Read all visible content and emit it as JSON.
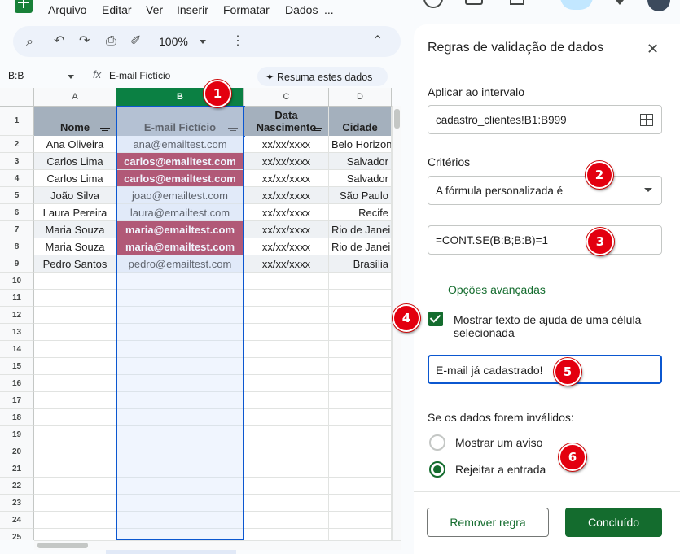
{
  "menu": [
    "Arquivo",
    "Editar",
    "Ver",
    "Inserir",
    "Formatar",
    "Dados",
    "..."
  ],
  "toolbar": {
    "zoom": "100%"
  },
  "formula_bar": {
    "name_box": "B:B",
    "content": "E-mail Fictício",
    "summarize": "Resuma estes dados"
  },
  "sheet": {
    "columns": [
      "A",
      "B",
      "C",
      "D"
    ],
    "headers": [
      "Nome",
      "E-mail Fictício",
      "Data\nNascimento",
      "Cidade"
    ],
    "rows": [
      {
        "name": "Ana Oliveira",
        "email": "ana@emailtest.com",
        "date": "xx/xx/xxxx",
        "city": "Belo Horizonte",
        "dup": false
      },
      {
        "name": "Carlos Lima",
        "email": "carlos@emailtest.com",
        "date": "xx/xx/xxxx",
        "city": "Salvador",
        "dup": true
      },
      {
        "name": "Carlos Lima",
        "email": "carlos@emailtest.com",
        "date": "xx/xx/xxxx",
        "city": "Salvador",
        "dup": true
      },
      {
        "name": "João Silva",
        "email": "joao@emailtest.com",
        "date": "xx/xx/xxxx",
        "city": "São Paulo",
        "dup": false
      },
      {
        "name": "Laura Pereira",
        "email": "laura@emailtest.com",
        "date": "xx/xx/xxxx",
        "city": "Recife",
        "dup": false
      },
      {
        "name": "Maria Souza",
        "email": "maria@emailtest.com",
        "date": "xx/xx/xxxx",
        "city": "Rio de Janeiro",
        "dup": true
      },
      {
        "name": "Maria Souza",
        "email": "maria@emailtest.com",
        "date": "xx/xx/xxxx",
        "city": "Rio de Janeiro",
        "dup": true
      },
      {
        "name": "Pedro Santos",
        "email": "pedro@emailtest.com",
        "date": "xx/xx/xxxx",
        "city": "Brasília",
        "dup": false
      }
    ],
    "row_numbers": [
      "1",
      "2",
      "3",
      "4",
      "5",
      "6",
      "7",
      "8",
      "9",
      "10",
      "11",
      "12",
      "13",
      "14",
      "15",
      "16",
      "17",
      "18",
      "19",
      "20",
      "21",
      "22",
      "23",
      "24",
      "25"
    ]
  },
  "panel": {
    "title": "Regras de validação de dados",
    "apply_label": "Aplicar ao intervalo",
    "range": "cadastro_clientes!B1:B999",
    "criteria_label": "Critérios",
    "criteria": "A fórmula personalizada é",
    "formula": "=CONT.SE(B:B;B:B)=1",
    "advanced": "Opções avançadas",
    "show_help": "Mostrar texto de ajuda de uma célula selecionada",
    "help_text": "E-mail já cadastrado!",
    "invalid_label": "Se os dados forem inválidos:",
    "option_warn": "Mostrar um aviso",
    "option_reject": "Rejeitar a entrada",
    "remove": "Remover regra",
    "done": "Concluído"
  },
  "badges": [
    "1",
    "2",
    "3",
    "4",
    "5",
    "6"
  ],
  "colors": {
    "accent": "#146c2e",
    "duplicate": "#9e1030",
    "header_fill": "#a4b0bd",
    "badge": "#e3000f"
  }
}
